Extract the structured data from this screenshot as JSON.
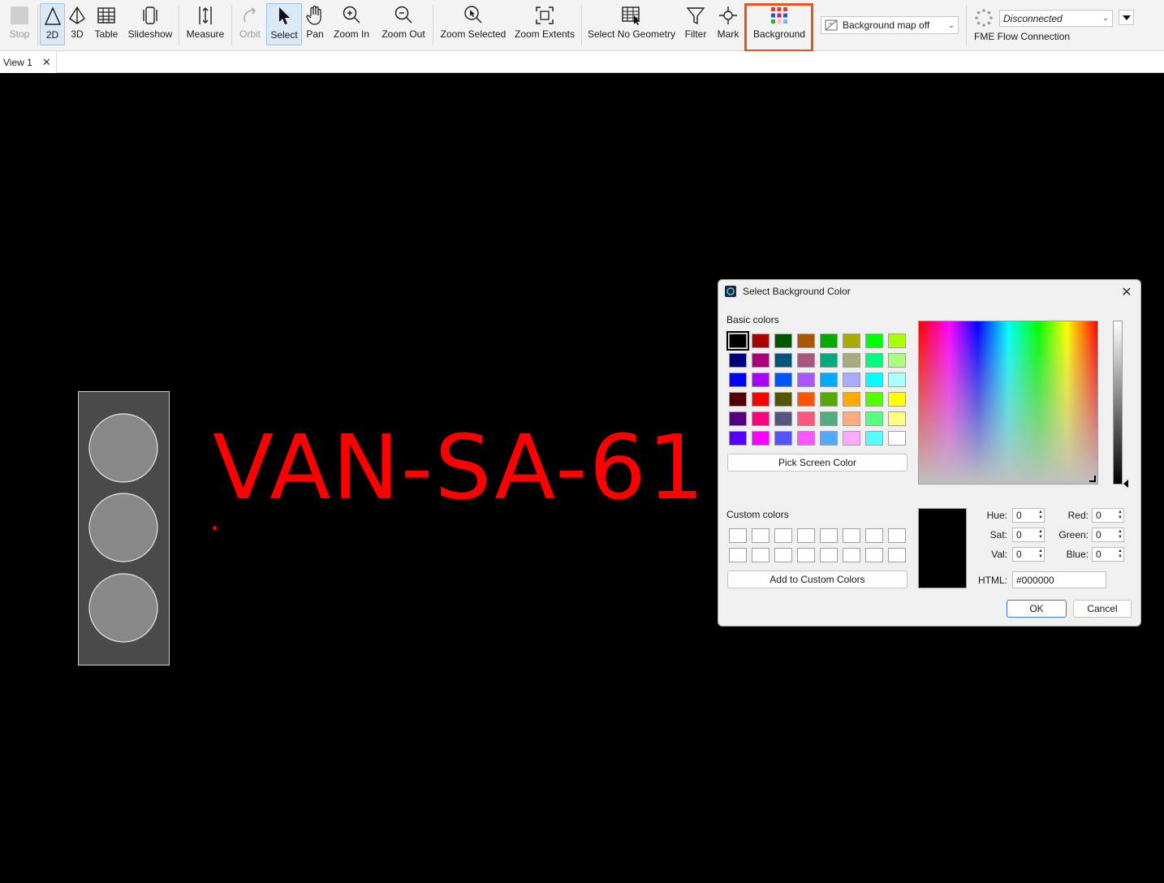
{
  "toolbar": {
    "stop": "Stop",
    "twod": "2D",
    "threed": "3D",
    "table": "Table",
    "slideshow": "Slideshow",
    "measure": "Measure",
    "orbit": "Orbit",
    "select": "Select",
    "pan": "Pan",
    "zoom_in": "Zoom In",
    "zoom_out": "Zoom Out",
    "zoom_selected": "Zoom Selected",
    "zoom_extents": "Zoom Extents",
    "select_no_geometry": "Select No Geometry",
    "filter": "Filter",
    "mark": "Mark",
    "background": "Background",
    "background_map": "Background map off",
    "connection_status": "Disconnected",
    "fme_flow": "FME Flow Connection",
    "highlight_color": "#e8531d"
  },
  "tabs": [
    {
      "label": "View 1"
    }
  ],
  "canvas": {
    "label_text": "VAN-SA-61",
    "label_color": "#ff0000",
    "background": "#000000"
  },
  "dialog": {
    "title": "Select Background Color",
    "basic_colors_label": "Basic colors",
    "basic_colors": [
      "#000000",
      "#aa0000",
      "#005500",
      "#aa5500",
      "#00aa00",
      "#aaaa00",
      "#00ff00",
      "#aaff00",
      "#00007f",
      "#aa007f",
      "#00557f",
      "#aa557f",
      "#00aa7f",
      "#aaaa7f",
      "#00ff7f",
      "#aaff7f",
      "#0000ff",
      "#aa00ff",
      "#0055ff",
      "#aa55ff",
      "#00aaff",
      "#aaaaff",
      "#00ffff",
      "#aaffff",
      "#550000",
      "#ff0000",
      "#555500",
      "#ff5500",
      "#55aa00",
      "#ffaa00",
      "#55ff00",
      "#ffff00",
      "#55007f",
      "#ff007f",
      "#55557f",
      "#ff557f",
      "#55aa7f",
      "#ffaa7f",
      "#55ff7f",
      "#ffff7f",
      "#5500ff",
      "#ff00ff",
      "#5555ff",
      "#ff55ff",
      "#55aaff",
      "#ffaaff",
      "#55ffff",
      "#ffffff"
    ],
    "pick_screen_color": "Pick Screen Color",
    "custom_colors_label": "Custom colors",
    "add_custom": "Add to Custom Colors",
    "fields": {
      "hue_label": "Hue:",
      "hue": "0",
      "sat_label": "Sat:",
      "sat": "0",
      "val_label": "Val:",
      "val": "0",
      "red_label": "Red:",
      "red": "0",
      "green_label": "Green:",
      "green": "0",
      "blue_label": "Blue:",
      "blue": "0",
      "html_label": "HTML:",
      "html": "#000000"
    },
    "ok": "OK",
    "cancel": "Cancel"
  }
}
